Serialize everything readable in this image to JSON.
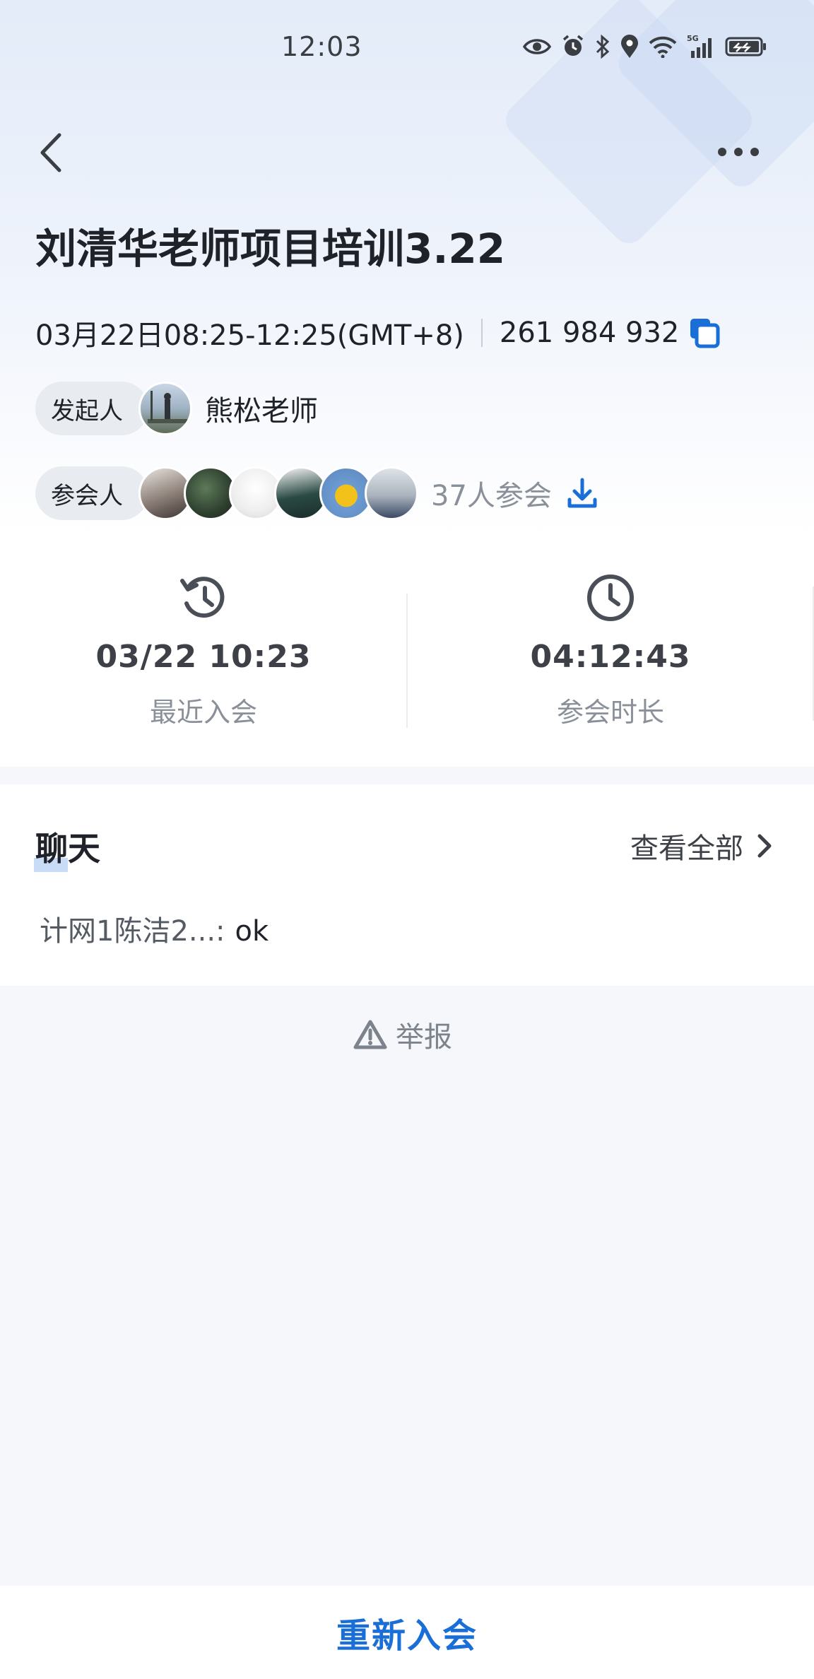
{
  "status_bar": {
    "time": "12:03",
    "network": "5G"
  },
  "meeting": {
    "title": "刘清华老师项目培训3.22",
    "time_range": "03月22日08:25-12:25(GMT+8)",
    "meeting_id": "261 984 932"
  },
  "organizer": {
    "label": "发起人",
    "name": "熊松老师"
  },
  "participants": {
    "label": "参会人",
    "count_text": "37人参会",
    "avatars": [
      "avatar-1",
      "avatar-2",
      "avatar-3",
      "avatar-4",
      "avatar-5",
      "avatar-6"
    ]
  },
  "stats": {
    "recent_join": {
      "value": "03/22 10:23",
      "label": "最近入会",
      "icon": "history-icon"
    },
    "duration": {
      "value": "04:12:43",
      "label": "参会时长",
      "icon": "clock-icon"
    }
  },
  "chat": {
    "title": "聊天",
    "view_all": "查看全部",
    "last_message": {
      "sender": "计网1陈洁2...:",
      "text": "ok"
    }
  },
  "report": {
    "label": "举报"
  },
  "bottom": {
    "rejoin_label": "重新入会"
  },
  "colors": {
    "accent": "#1a6ed8",
    "muted": "#8a9099"
  }
}
